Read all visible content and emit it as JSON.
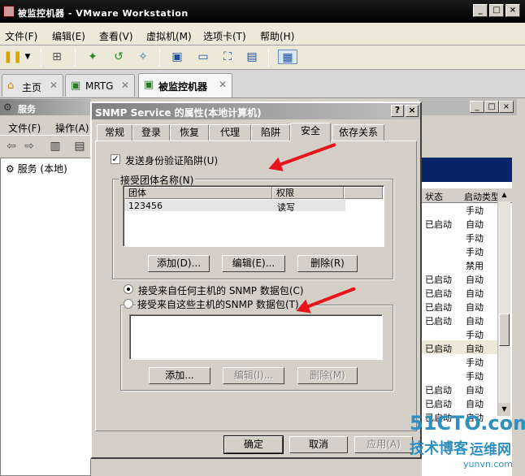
{
  "vmware": {
    "title": "被监控机器 - VMware Workstation",
    "menu": [
      "文件(F)",
      "编辑(E)",
      "查看(V)",
      "虚拟机(M)",
      "选项卡(T)",
      "帮助(H)"
    ],
    "tabs": [
      {
        "label": "主页",
        "icon": "home-icon"
      },
      {
        "label": "MRTG",
        "icon": "vm-icon"
      },
      {
        "label": "被监控机器",
        "icon": "vm-icon",
        "active": true
      }
    ]
  },
  "services": {
    "title": "服务",
    "menu": [
      "文件(F)",
      "操作(A)"
    ],
    "tree_root": "服务 (本地)",
    "columns": [
      "状态",
      "启动类型"
    ],
    "rows": [
      {
        "status": "",
        "startup": "手动"
      },
      {
        "status": "已启动",
        "startup": "自动"
      },
      {
        "status": "",
        "startup": "手动"
      },
      {
        "status": "",
        "startup": "手动"
      },
      {
        "status": "",
        "startup": "禁用"
      },
      {
        "status": "已启动",
        "startup": "自动"
      },
      {
        "status": "已启动",
        "startup": "自动"
      },
      {
        "status": "已启动",
        "startup": "自动"
      },
      {
        "status": "已启动",
        "startup": "自动"
      },
      {
        "status": "",
        "startup": "手动"
      },
      {
        "status": "已启动",
        "startup": "自动"
      },
      {
        "status": "",
        "startup": "手动"
      },
      {
        "status": "",
        "startup": "手动"
      },
      {
        "status": "已启动",
        "startup": "自动"
      },
      {
        "status": "已启动",
        "startup": "自动"
      },
      {
        "status": "已启动",
        "startup": "自动"
      }
    ],
    "selected_row": 10
  },
  "dialog": {
    "title": "SNMP Service 的属性(本地计算机)",
    "help_btn": "?",
    "close_btn": "×",
    "tabs": [
      "常规",
      "登录",
      "恢复",
      "代理",
      "陷阱",
      "安全",
      "依存关系"
    ],
    "active_tab": "安全",
    "send_auth_trap": {
      "label": "发送身份验证陷阱(U)",
      "checked": true
    },
    "community": {
      "group_label": "接受团体名称(N)",
      "headers": [
        "团体",
        "权限"
      ],
      "rows": [
        {
          "name": "123456",
          "rights": "读写"
        }
      ],
      "buttons": {
        "add": "添加(D)...",
        "edit": "编辑(E)...",
        "remove": "删除(R)"
      }
    },
    "accept_any": {
      "label": "接受来自任何主机的 SNMP 数据包(C)",
      "selected": true
    },
    "accept_these": {
      "label": "接受来自这些主机的SNMP 数据包(T)",
      "selected": false
    },
    "hosts_buttons": {
      "add": "添加...",
      "edit": "编辑(I)...",
      "remove": "删除(M)"
    },
    "footer": {
      "ok": "确定",
      "cancel": "取消",
      "apply": "应用(A)"
    }
  },
  "watermark": {
    "line1": "51CTO.com",
    "line2": "技术博客",
    "line3": "运维网",
    "line4": "yunvn.com"
  },
  "colors": {
    "arrow": "#e8141b",
    "selection": "#0a246a"
  }
}
